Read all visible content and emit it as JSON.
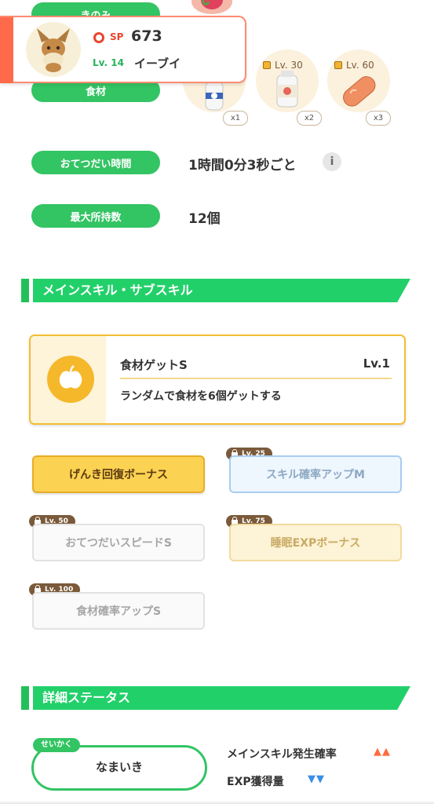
{
  "berries": {
    "label": "きのみ"
  },
  "ingredients": {
    "label": "食材",
    "items": [
      {
        "icon": "milk-bottle-icon",
        "count": "x1",
        "unlock": ""
      },
      {
        "icon": "milk-bottle-icon",
        "count": "x2",
        "unlock": "Lv. 30"
      },
      {
        "icon": "sausage-icon",
        "count": "x3",
        "unlock": "Lv. 60"
      }
    ]
  },
  "pokemon_card": {
    "sp_label": "SP",
    "sp_value": "673",
    "level": "Lv. 14",
    "name": "イーブイ",
    "accent": "#ff6b4a"
  },
  "help_time": {
    "label": "おてつだい時間",
    "value": "1時間0分3秒ごと"
  },
  "max_carry": {
    "label": "最大所持数",
    "value": "12個"
  },
  "skills_section": {
    "title": "メインスキル・サブスキル"
  },
  "main_skill": {
    "name": "食材ゲットS",
    "level": "Lv.1",
    "description": "ランダムで食材を6個ゲットする",
    "icon": "apple-icon"
  },
  "sub_skills": [
    {
      "label": "げんき回復ボーナス",
      "lock": ""
    },
    {
      "label": "スキル確率アップM",
      "lock": "Lv. 25"
    },
    {
      "label": "おてつだいスピードS",
      "lock": "Lv. 50"
    },
    {
      "label": "睡眠EXPボーナス",
      "lock": "Lv. 75"
    },
    {
      "label": "食材確率アップS",
      "lock": "Lv. 100"
    }
  ],
  "details_section": {
    "title": "詳細ステータス"
  },
  "nature": {
    "tag": "せいかく",
    "value": "なまいき",
    "effects": [
      {
        "label": "メインスキル発生確率",
        "arrows": "▲▲",
        "color": "#ff6a3d"
      },
      {
        "label": "EXP獲得量",
        "arrows": "▼▼",
        "color": "#3a8ee8"
      }
    ]
  }
}
